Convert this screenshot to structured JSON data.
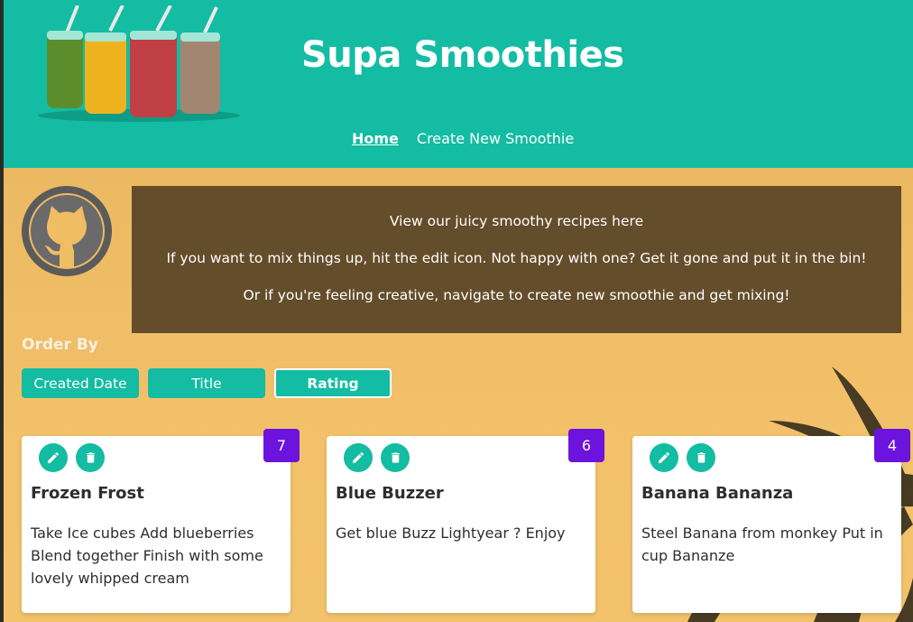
{
  "site": {
    "title": "Supa Smoothies"
  },
  "nav": {
    "items": [
      {
        "label": "Home",
        "active": true
      },
      {
        "label": "Create New Smoothie",
        "active": false
      }
    ]
  },
  "intro": {
    "lines": [
      "View our juicy smoothy recipes here",
      "If you want to mix things up, hit the edit icon. Not happy with one? Get it gone and put it in the bin!",
      "Or if you're feeling creative, navigate to create new smoothie and get mixing!"
    ]
  },
  "order_by": {
    "label": "Order By",
    "options": [
      {
        "label": "Created Date"
      },
      {
        "label": "Title"
      },
      {
        "label": "Rating",
        "active": true
      }
    ]
  },
  "smoothies": [
    {
      "rating": "7",
      "title": "Frozen Frost",
      "method": "Take Ice cubes Add blueberries Blend together Finish with some lovely whipped cream"
    },
    {
      "rating": "6",
      "title": "Blue Buzzer",
      "method": "Get blue Buzz Lightyear ? Enjoy"
    },
    {
      "rating": "4",
      "title": "Banana Bananza",
      "method": "Steel Banana from monkey Put in cup Bananze"
    }
  ],
  "icons": {
    "edit": "pencil-icon",
    "delete": "trash-icon",
    "github": "github-icon"
  },
  "colors": {
    "primary": "#13bca2",
    "rating_badge": "#6c14dd",
    "background": "#f0bd62"
  }
}
